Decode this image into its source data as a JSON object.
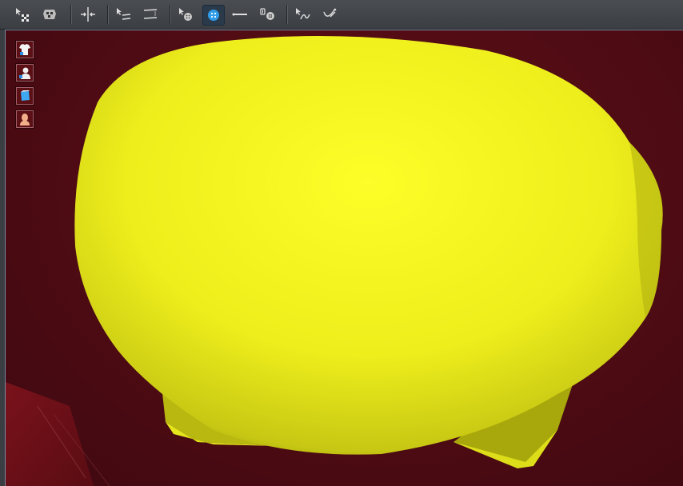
{
  "toolbar": {
    "groups": [
      [
        "select-pattern-icon",
        "select-segment-icon"
      ],
      [
        "fold-arrangement-icon"
      ],
      [
        "edit-pattern-icon",
        "ruler-icon"
      ],
      [
        "add-button-icon",
        "button-icon",
        "line-icon",
        "buttonhole-icon"
      ],
      [
        "select-edit-icon",
        "topstitch-icon"
      ]
    ],
    "active": "button-icon"
  },
  "viewport": {
    "side_buttons": [
      "show-garment-icon",
      "show-avatar-icon",
      "show-pattern-icon",
      "show-skin-icon"
    ],
    "colors": {
      "background": "#4d0b13",
      "object": "#f2f21e",
      "floor": "#6a1018"
    }
  }
}
